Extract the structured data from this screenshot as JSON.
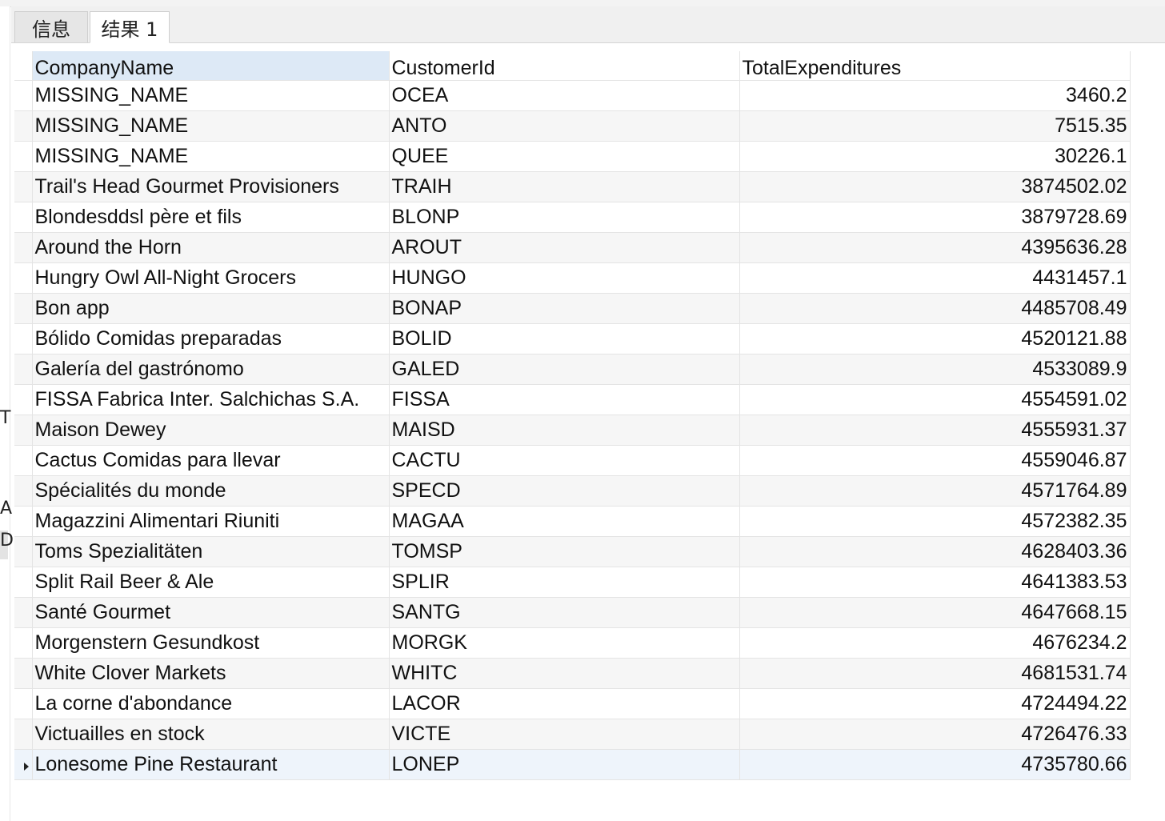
{
  "tabs": [
    {
      "label": "信息",
      "active": false
    },
    {
      "label": "结果 1",
      "active": true
    }
  ],
  "columns": [
    "CompanyName",
    "CustomerId",
    "TotalExpenditures"
  ],
  "rows": [
    [
      "MISSING_NAME",
      "OCEA",
      "3460.2"
    ],
    [
      "MISSING_NAME",
      "ANTO",
      "7515.35"
    ],
    [
      "MISSING_NAME",
      "QUEE",
      "30226.1"
    ],
    [
      "Trail's Head Gourmet Provisioners",
      "TRAIH",
      "3874502.02"
    ],
    [
      "Blondesddsl père et fils",
      "BLONP",
      "3879728.69"
    ],
    [
      "Around the Horn",
      "AROUT",
      "4395636.28"
    ],
    [
      "Hungry Owl All-Night Grocers",
      "HUNGO",
      "4431457.1"
    ],
    [
      "Bon app",
      "BONAP",
      "4485708.49"
    ],
    [
      "Bólido Comidas preparadas",
      "BOLID",
      "4520121.88"
    ],
    [
      "Galería del gastrónomo",
      "GALED",
      "4533089.9"
    ],
    [
      "FISSA Fabrica Inter. Salchichas S.A.",
      "FISSA",
      "4554591.02"
    ],
    [
      "Maison Dewey",
      "MAISD",
      "4555931.37"
    ],
    [
      "Cactus Comidas para llevar",
      "CACTU",
      "4559046.87"
    ],
    [
      "Spécialités du monde",
      "SPECD",
      "4571764.89"
    ],
    [
      "Magazzini Alimentari Riuniti",
      "MAGAA",
      "4572382.35"
    ],
    [
      "Toms Spezialitäten",
      "TOMSP",
      "4628403.36"
    ],
    [
      "Split Rail Beer & Ale",
      "SPLIR",
      "4641383.53"
    ],
    [
      "Santé Gourmet",
      "SANTG",
      "4647668.15"
    ],
    [
      "Morgenstern Gesundkost",
      "MORGK",
      "4676234.2"
    ],
    [
      "White Clover Markets",
      "WHITC",
      "4681531.74"
    ],
    [
      "La corne d'abondance",
      "LACOR",
      "4724494.22"
    ],
    [
      "Victuailles en stock",
      "VICTE",
      "4726476.33"
    ],
    [
      "Lonesome Pine Restaurant",
      "LONEP",
      "4735780.66"
    ]
  ],
  "current_row": 22,
  "gutter": [
    "T",
    "A",
    "D"
  ]
}
